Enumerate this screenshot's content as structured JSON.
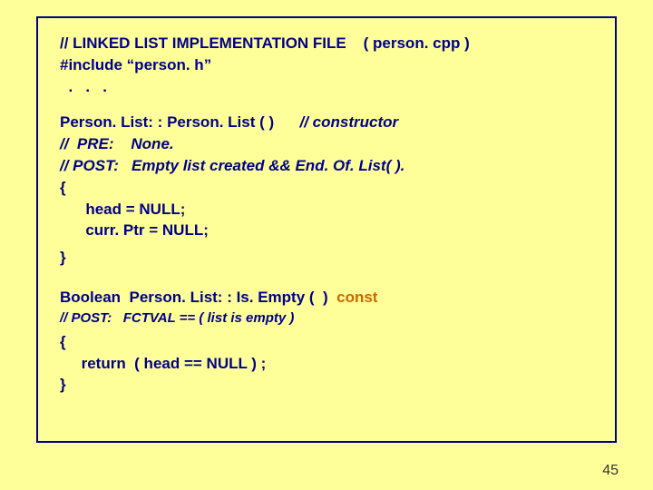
{
  "header": {
    "l1": "// LINKED LIST IMPLEMENTATION FILE    ( person. cpp )",
    "l2": "#include “person. h”",
    "l3": "  .   .   ."
  },
  "ctor": {
    "sig_a": "Person. List: : Person. List ( )      ",
    "sig_b": "// constructor",
    "pre": "//  PRE:    None.",
    "post": "// POST:   Empty list created && End. Of. List( ).",
    "open": "{",
    "b1": "      head = NULL;",
    "b2": "      curr. Ptr = NULL;",
    "close": "}"
  },
  "isempty": {
    "sig_a": "Boolean  Person. List: : Is. Empty (  )  ",
    "sig_b": "const",
    "post": "// POST:   FCTVAL == ( list is empty )",
    "open": "{",
    "b1": "     return  ( head == NULL ) ;",
    "close": "}"
  },
  "pagenum": "45"
}
